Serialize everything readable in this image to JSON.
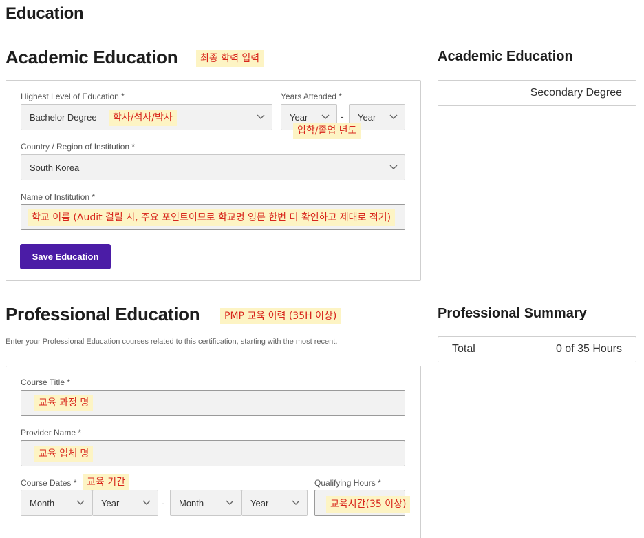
{
  "page": {
    "title": "Education"
  },
  "academic": {
    "heading": "Academic Education",
    "note": "최종 학력 입력",
    "highest_level_label": "Highest Level of Education *",
    "highest_level_value": "Bachelor Degree",
    "highest_level_note": "학사/석사/박사",
    "years_label": "Years Attended *",
    "year_from": "Year",
    "year_to": "Year",
    "years_dash": "-",
    "years_note": "입학/졸업 년도",
    "country_label": "Country / Region of Institution *",
    "country_value": "South Korea",
    "institution_label": "Name of Institution *",
    "institution_note": "학교 이름 (Audit 걸릴 시, 주요 포인트이므로 학교명 영문 한번 더 확인하고 제대로 적기)",
    "save_label": "Save Education"
  },
  "academic_summary": {
    "heading": "Academic Education",
    "value": "Secondary Degree"
  },
  "professional": {
    "heading": "Professional Education",
    "note": "PMP 교육 이력 (35H 이상)",
    "helper": "Enter your Professional Education courses related to this certification, starting with the most recent.",
    "course_title_label": "Course Title *",
    "course_title_note": "교육 과정 명",
    "provider_label": "Provider Name *",
    "provider_note": "교육 업체 명",
    "course_dates_label": "Course Dates *",
    "course_dates_note": "교육 기간",
    "start_month": "Month",
    "start_year": "Year",
    "dates_dash": "-",
    "end_month": "Month",
    "end_year": "Year",
    "hours_label": "Qualifying Hours *",
    "hours_note": "교육시간(35 이상)"
  },
  "professional_summary": {
    "heading": "Professional Summary",
    "total_label": "Total",
    "total_value": "0 of 35 Hours"
  },
  "icons": {
    "dropdown": "chevron-down-icon"
  },
  "colors": {
    "accent": "#4b1ca6",
    "note_bg": "#fdf4c4",
    "note_text": "#d8261c"
  }
}
